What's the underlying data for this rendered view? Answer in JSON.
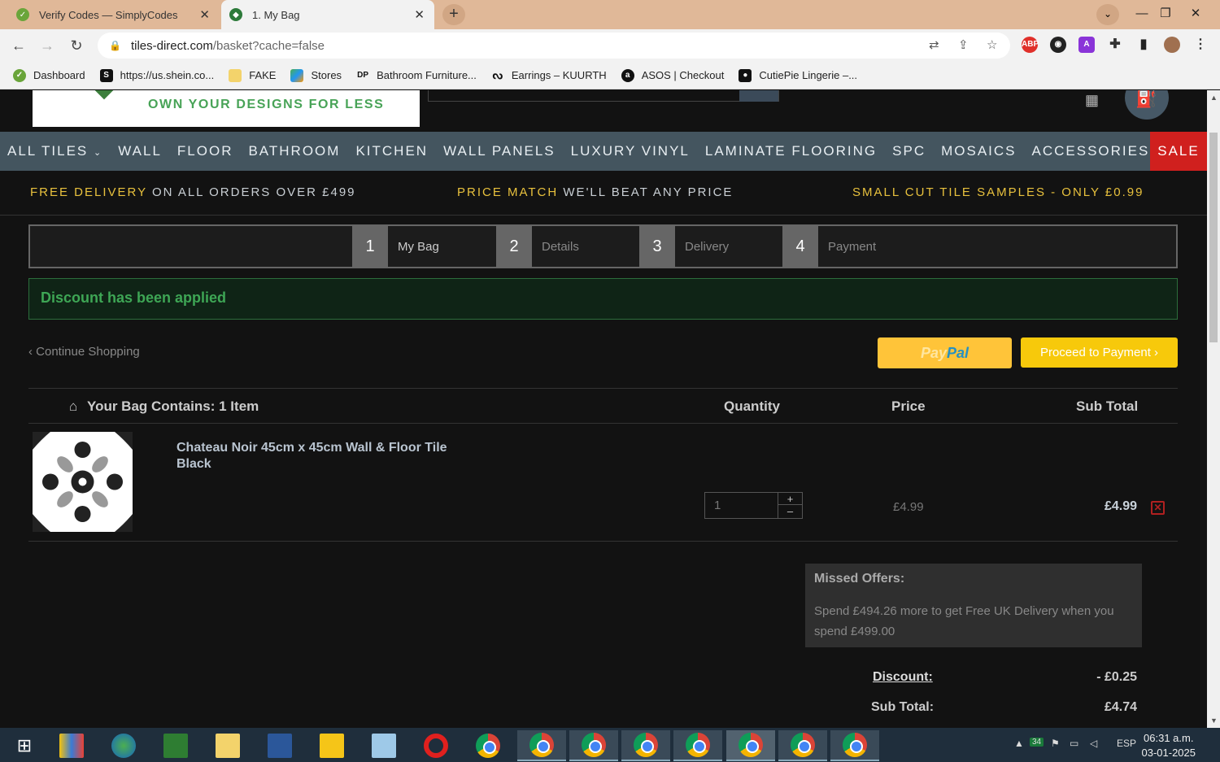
{
  "browser": {
    "tabs": [
      {
        "title": "Verify Codes — SimplyCodes",
        "active": false
      },
      {
        "title": "1. My Bag",
        "active": true
      }
    ],
    "url_host": "tiles-direct.com",
    "url_path": "/basket?cache=false",
    "bookmarks": [
      {
        "label": "Dashboard",
        "icon": "simplycodes-icon"
      },
      {
        "label": "https://us.shein.co...",
        "icon": "shein-icon"
      },
      {
        "label": "FAKE",
        "icon": "folder-icon"
      },
      {
        "label": "Stores",
        "icon": "apps-icon"
      },
      {
        "label": "Bathroom Furniture...",
        "icon": "dp-icon"
      },
      {
        "label": "Earrings – KUURTH",
        "icon": "kuurth-icon"
      },
      {
        "label": "ASOS | Checkout",
        "icon": "asos-icon"
      },
      {
        "label": "CutiePie Lingerie –...",
        "icon": "cutiepie-icon"
      }
    ],
    "extensions": [
      "ABP",
      "A"
    ]
  },
  "site": {
    "logo_tagline": "OWN YOUR DESIGNS FOR LESS",
    "nav": [
      "ALL TILES",
      "WALL",
      "FLOOR",
      "BATHROOM",
      "KITCHEN",
      "WALL PANELS",
      "LUXURY VINYL",
      "LAMINATE FLOORING",
      "SPC",
      "MOSAICS",
      "ACCESSORIES"
    ],
    "nav_sale": "SALE",
    "promos": [
      {
        "highlight": "FREE DELIVERY",
        "text": " ON ALL ORDERS OVER £499"
      },
      {
        "highlight": "PRICE MATCH",
        "text": " WE'LL BEAT ANY PRICE"
      },
      {
        "highlight": "SMALL CUT TILE SAMPLES - ONLY £0.99",
        "text": ""
      }
    ]
  },
  "checkout_steps": [
    {
      "num": "1",
      "label": "My Bag"
    },
    {
      "num": "2",
      "label": "Details"
    },
    {
      "num": "3",
      "label": "Delivery"
    },
    {
      "num": "4",
      "label": "Payment"
    }
  ],
  "alert": "Discount has been applied",
  "continue_shopping": "‹ Continue Shopping",
  "paypal": {
    "pay": "Pay",
    "pal": "Pal"
  },
  "proceed": "Proceed to Payment ›",
  "table": {
    "bag_title": "Your Bag Contains: 1 Item",
    "col_quantity": "Quantity",
    "col_price": "Price",
    "col_subtotal": "Sub Total"
  },
  "item": {
    "name": "Chateau Noir 45cm x 45cm Wall & Floor Tile Black",
    "quantity": "1",
    "price": "£4.99",
    "subtotal": "£4.99"
  },
  "missed_offers": {
    "title": "Missed Offers:",
    "body": "Spend £494.26 more to get Free UK Delivery when you spend £499.00"
  },
  "totals": {
    "discount_label": "Discount:",
    "discount_value": "- £0.25",
    "subtotal_label": "Sub Total:",
    "subtotal_value": "£4.74"
  },
  "taskbar": {
    "tray_badge": "34",
    "lang": "ESP",
    "time": "06:31 a.m.",
    "date": "03-01-2025"
  },
  "colors": {
    "accent_yellow": "#f7c90b",
    "nav_bg": "#44555f",
    "sale_red": "#d0201e",
    "success_green": "#3ea655"
  }
}
